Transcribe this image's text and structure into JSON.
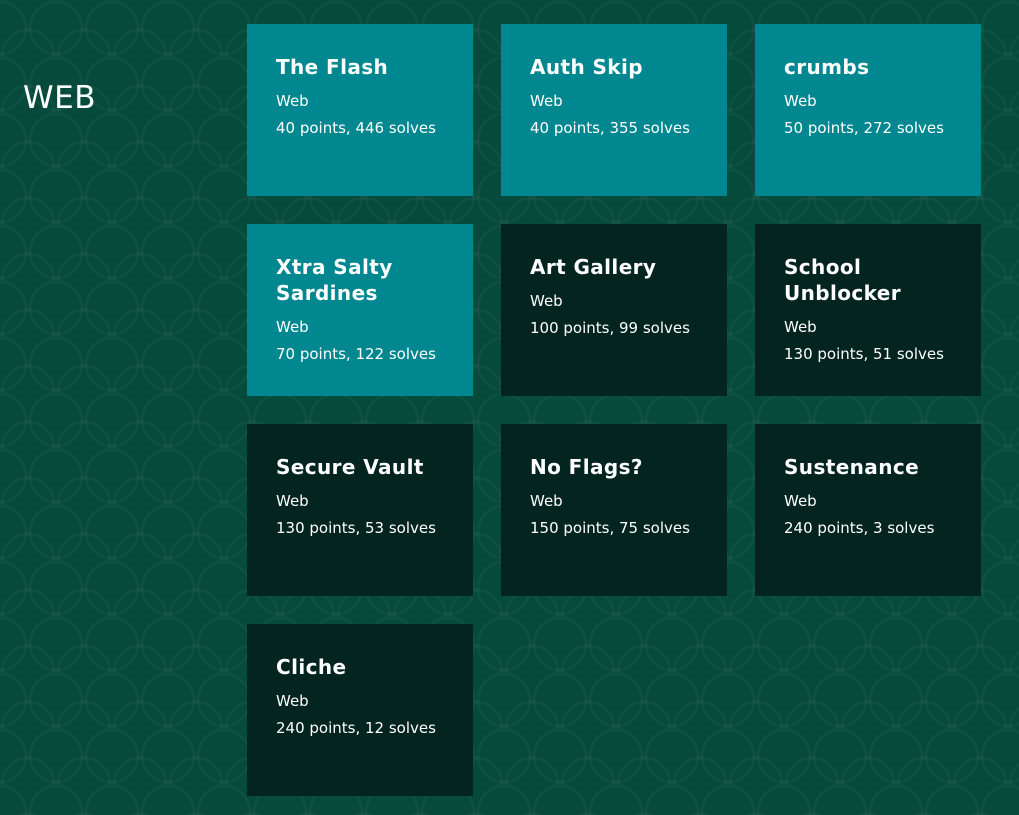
{
  "category": {
    "title": "WEB"
  },
  "colors": {
    "background": "#054a3b",
    "solved_card": "#00878f",
    "unsolved_card": "#03241f",
    "text": "#ffffff"
  },
  "challenges": [
    {
      "title": "The Flash",
      "category": "Web",
      "stats": "40 points, 446 solves",
      "solved": true
    },
    {
      "title": "Auth Skip",
      "category": "Web",
      "stats": "40 points, 355 solves",
      "solved": true
    },
    {
      "title": "crumbs",
      "category": "Web",
      "stats": "50 points, 272 solves",
      "solved": true
    },
    {
      "title": "Xtra Salty Sardines",
      "category": "Web",
      "stats": "70 points, 122 solves",
      "solved": true
    },
    {
      "title": "Art Gallery",
      "category": "Web",
      "stats": "100 points, 99 solves",
      "solved": false
    },
    {
      "title": "School Unblocker",
      "category": "Web",
      "stats": "130 points, 51 solves",
      "solved": false
    },
    {
      "title": "Secure Vault",
      "category": "Web",
      "stats": "130 points, 53 solves",
      "solved": false
    },
    {
      "title": "No Flags?",
      "category": "Web",
      "stats": "150 points, 75 solves",
      "solved": false
    },
    {
      "title": "Sustenance",
      "category": "Web",
      "stats": "240 points, 3 solves",
      "solved": false
    },
    {
      "title": "Cliche",
      "category": "Web",
      "stats": "240 points, 12 solves",
      "solved": false
    }
  ]
}
